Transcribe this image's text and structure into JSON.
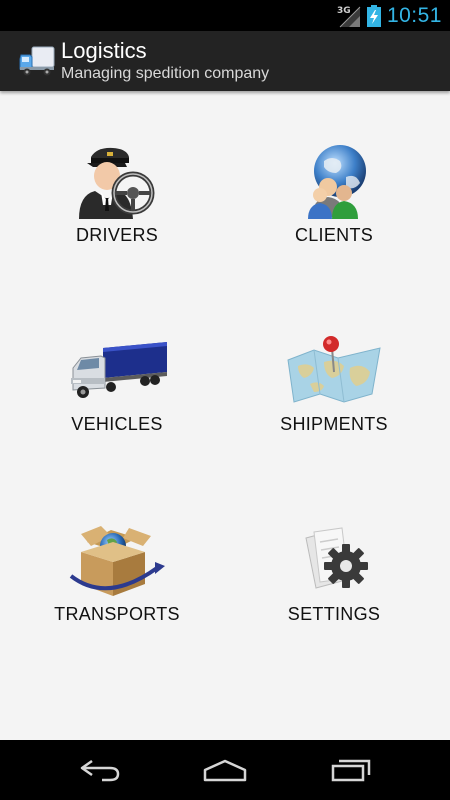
{
  "status_bar": {
    "network_type": "3G",
    "time": "10:51",
    "clock_color": "#33b5e5"
  },
  "action_bar": {
    "title": "Logistics",
    "subtitle": "Managing spedition company",
    "icon": "truck-icon"
  },
  "menu": {
    "items": [
      {
        "label": "DRIVERS",
        "icon": "driver-icon"
      },
      {
        "label": "CLIENTS",
        "icon": "clients-globe-icon"
      },
      {
        "label": "VEHICLES",
        "icon": "truck-trailer-icon"
      },
      {
        "label": "SHIPMENTS",
        "icon": "map-pin-icon"
      },
      {
        "label": "TRANSPORTS",
        "icon": "box-globe-icon"
      },
      {
        "label": "SETTINGS",
        "icon": "gear-icon"
      }
    ]
  },
  "nav_bar": {
    "buttons": [
      "back-icon",
      "home-icon",
      "recent-apps-icon"
    ]
  }
}
